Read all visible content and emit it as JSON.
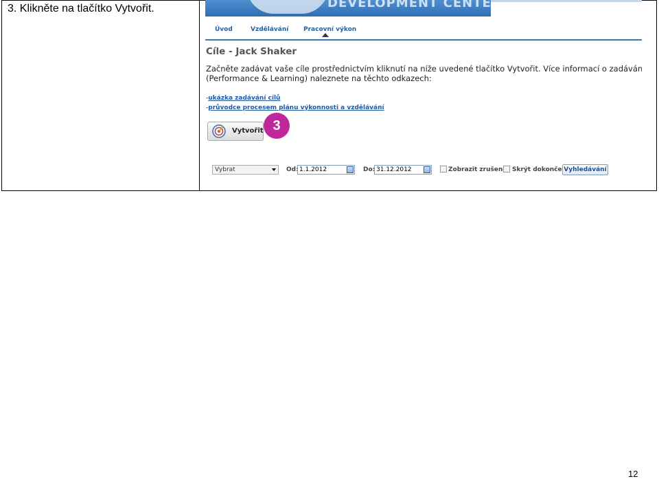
{
  "step_text": "3. Klikněte na tlačítko Vytvořit.",
  "banner": {
    "text": "DEVELOPMENT CENTER"
  },
  "nav": {
    "items": [
      "Úvod",
      "Vzdělávání",
      "Pracovní výkon"
    ]
  },
  "page_title": "Cíle - Jack Shaker",
  "intro": {
    "line1": "Začněte zadávat vaše cíle prostřednictvím kliknutí na níže uvedené tlačítko Vytvořit. Více informací o zadávání cílů nebo ob",
    "line2": "(Performance & Learning) naleznete na těchto odkazech:"
  },
  "links": [
    "ukázka zadávání cílů",
    "průvodce procesem plánu výkonnosti a vzdělávání"
  ],
  "create_button": {
    "label": "Vytvořit",
    "icon": "target-icon"
  },
  "callout": {
    "number": "3",
    "color": "#c0279a"
  },
  "filters": {
    "select_value": "Vybrat",
    "from_label": "Od:",
    "from_value": "1.1.2012",
    "to_label": "Do:",
    "to_value": "31.12.2012",
    "show_cancelled": "Zobrazit zrušené",
    "hide_completed": "Skrýt dokončené",
    "search_button": "Vyhledávání"
  },
  "page_number": "12"
}
